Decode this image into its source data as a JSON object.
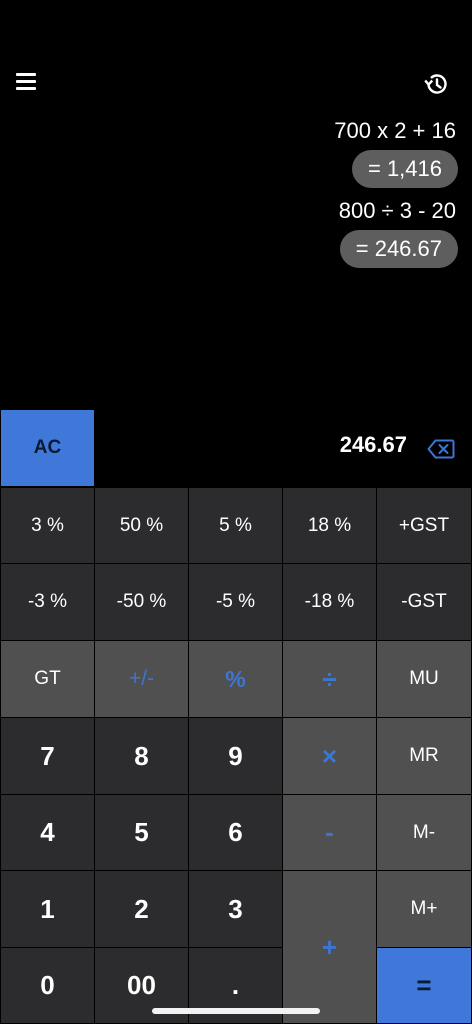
{
  "header": {
    "menu_icon": "hamburger-menu-icon",
    "history_icon": "history-clock-icon"
  },
  "tape": [
    {
      "expression": "700 x 2 + 16",
      "result": "= 1,416"
    },
    {
      "expression": "800 ÷ 3 - 20",
      "result": "= 246.67"
    }
  ],
  "display": {
    "clear_label": "AC",
    "value": "246.67",
    "backspace_icon": "backspace-icon"
  },
  "keys": {
    "pct3": "3 %",
    "pct50": "50 %",
    "pct5": "5 %",
    "pct18": "18 %",
    "plus_gst": "+GST",
    "minus_pct3": "-3 %",
    "minus_pct50": "-50 %",
    "minus_pct5": "-5 %",
    "minus_pct18": "-18 %",
    "minus_gst": "-GST",
    "gt": "GT",
    "sign": "+/-",
    "percent": "%",
    "divide": "÷",
    "mu": "MU",
    "seven": "7",
    "eight": "8",
    "nine": "9",
    "multiply": "×",
    "mr": "MR",
    "four": "4",
    "five": "5",
    "six": "6",
    "minus": "-",
    "m_minus": "M-",
    "one": "1",
    "two": "2",
    "three": "3",
    "plus": "+",
    "m_plus": "M+",
    "zero": "0",
    "double_zero": "00",
    "decimal": ".",
    "equals": "="
  },
  "colors": {
    "accent": "#3f78d8",
    "key_dark": "#2c2c2e",
    "key_mid": "#505050",
    "operator_text": "#3c76d4"
  }
}
